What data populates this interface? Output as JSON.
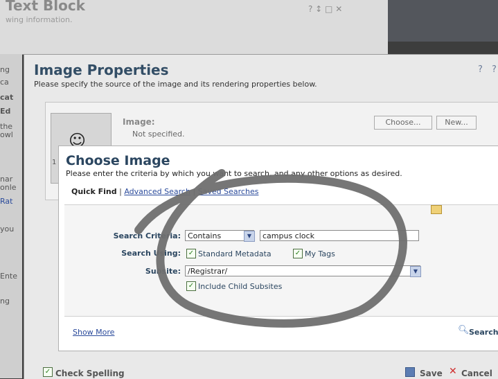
{
  "background_dialog": {
    "title": "Text Block",
    "subtitle": "wing information.",
    "controls": "? ↕ □ ✕",
    "left_fragments": [
      "ng",
      "ca",
      "cat",
      "Ed",
      "the",
      "owl",
      "nar",
      "onle",
      "Rat",
      "you",
      "Ente",
      "ng"
    ]
  },
  "image_properties": {
    "title": "Image Properties",
    "subtitle": "Please specify the source of the image and its rendering properties below.",
    "image_label": "Image:",
    "image_value": "Not specified.",
    "choose_button": "Choose...",
    "new_button": "New...",
    "help_icons": [
      "?",
      "?"
    ],
    "side_fragment": "1"
  },
  "choose_image": {
    "title": "Choose Image",
    "subtitle": "Please enter the criteria by which you want to search, and any other options as desired.",
    "tabs": {
      "quick_find": "Quick Find",
      "advanced_search": "Advanced Search",
      "saved_searches": "Saved Searches",
      "separator": "|"
    },
    "form": {
      "search_criteria_label": "Search Criteria:",
      "criteria_operator": "Contains",
      "criteria_value": "campus clock",
      "search_using_label": "Search Using:",
      "standard_metadata_label": "Standard Metadata",
      "my_tags_label": "My Tags",
      "subsite_label": "Subsite:",
      "subsite_value": "/Registrar/",
      "include_child_label": "Include Child Subsites"
    },
    "show_more": "Show More",
    "search_button": "Search"
  },
  "footer": {
    "check_spelling": "Check Spelling",
    "save": "Save",
    "cancel": "Cancel"
  },
  "colors": {
    "title_blue": "#2b4660",
    "link_blue": "#2a4a9b",
    "scribble": "#6f6f6f"
  }
}
